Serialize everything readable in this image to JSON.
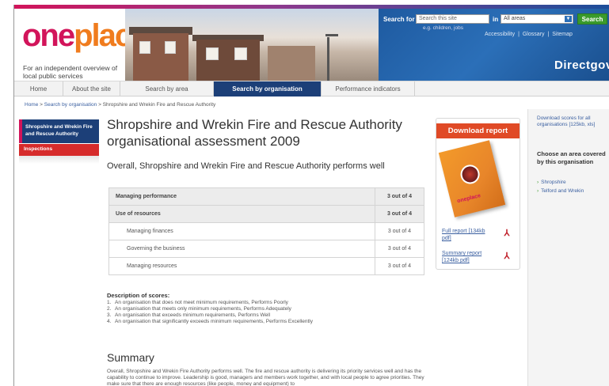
{
  "header": {
    "logo_one": "one",
    "logo_place": "place",
    "tagline": "For an independent overview of local public services",
    "search_label": "Search for",
    "search_value": "Search this site",
    "search_hint": "e.g. children, jobs",
    "in_label": "in",
    "area_select": "All areas",
    "search_button": "Search",
    "util_links": [
      "Accessibility",
      "Glossary",
      "Sitemap"
    ],
    "util_sep": "|",
    "directgov": "Directgov"
  },
  "nav": {
    "tabs": [
      "Home",
      "About the site",
      "Search by area",
      "Search by organisation",
      "Performance indicators"
    ],
    "active": "Search by organisation"
  },
  "breadcrumb": {
    "home": "Home",
    "sep": ">",
    "parent": "Search by organisation",
    "current": "Shropshire and Wrekin Fire and Rescue Authority"
  },
  "leftnav": {
    "items": [
      "Shropshire and Wrekin Fire and Rescue Authority",
      "Inspections"
    ]
  },
  "main": {
    "title": "Shropshire and Wrekin Fire and Rescue Authority organisational assessment 2009",
    "lead": "Overall, Shropshire and Wrekin Fire and Rescue Authority performs well",
    "scores": [
      {
        "label": "Managing performance",
        "value": "3 out of 4",
        "level": "top"
      },
      {
        "label": "Use of resources",
        "value": "3 out of 4",
        "level": "top"
      },
      {
        "label": "Managing finances",
        "value": "3 out of 4",
        "level": "sub"
      },
      {
        "label": "Governing the business",
        "value": "3 out of 4",
        "level": "sub"
      },
      {
        "label": "Managing resources",
        "value": "3 out of 4",
        "level": "sub"
      }
    ],
    "desc_title": "Description of scores:",
    "desc_items": [
      {
        "num": "1.",
        "text": "An organisation that does not meet minimum requirements, Performs Poorly"
      },
      {
        "num": "2.",
        "text": "An organisation that meets only minimum requirements, Performs Adequately"
      },
      {
        "num": "3.",
        "text": "An organisation that exceeds minimum requirements, Performs Well"
      },
      {
        "num": "4.",
        "text": "An organisation that significantly exceeds minimum requirements, Performs Excellently"
      }
    ],
    "summary_title": "Summary",
    "summary_text": "Overall, Shropshire and Wrekin Fire Authority performs well. The fire and rescue authority is delivering its priority services well and has the capability to continue to improve. Leadership is good, managers and members work together, and with local people to agree priorities. They make sure that there are enough resources (like people, money and equipment) to"
  },
  "download": {
    "heading": "Download report",
    "report_mini": "oneplace",
    "full_report": "Full report [134kb pdf]",
    "summary_report": "Summary report [124kb pdf]",
    "pdf_glyph": "⅄"
  },
  "sidebar": {
    "download_all": "Download scores for all organisations [125kb, xls]",
    "choose_title": "Choose an area covered by this organisation",
    "arrow": "›",
    "areas": [
      "Shropshire",
      "Telford and Wrekin"
    ]
  },
  "colors": {
    "brand_pink": "#d2145a",
    "brand_orange": "#f07c1e",
    "nav_active": "#1c3f78",
    "download_head": "#e04a26",
    "search_button": "#3a9a2c"
  }
}
